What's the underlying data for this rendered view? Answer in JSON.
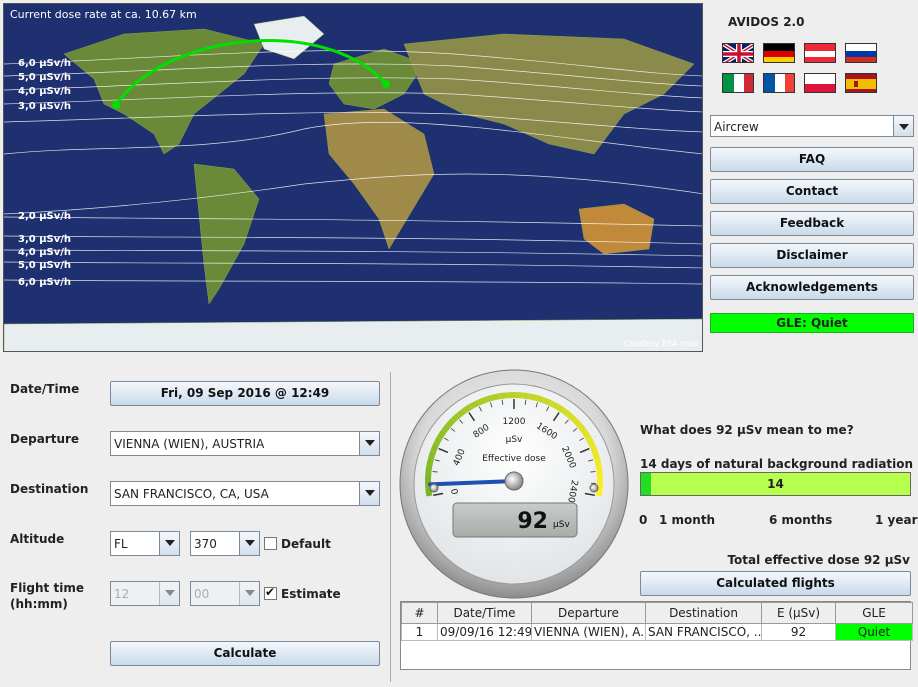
{
  "map": {
    "title": "Current dose rate at ca. 10.67 km",
    "credit": "Courtesy ESA map",
    "dose_labels_north": [
      "6,0 µSv/h",
      "5,0 µSv/h",
      "4,0 µSv/h",
      "3,0 µSv/h"
    ],
    "dose_labels_south": [
      "2,0 µSv/h",
      "3,0 µSv/h",
      "4,0 µSv/h",
      "5,0 µSv/h",
      "6,0 µSv/h"
    ],
    "route_color": "#00e000",
    "ocean_color": "#1d2f6b"
  },
  "sidebar": {
    "app_name": "AVIDOS 2.0",
    "flags": [
      "uk-flag",
      "germany-flag",
      "austria-flag",
      "russia-flag",
      "italy-flag",
      "france-flag",
      "poland-flag",
      "spain-flag"
    ],
    "role_select": "Aircrew",
    "buttons": {
      "faq": "FAQ",
      "contact": "Contact",
      "feedback": "Feedback",
      "disclaimer": "Disclaimer",
      "acknowledgements": "Acknowledgements"
    },
    "gle_status": "GLE: Quiet",
    "gle_color": "#00ff00"
  },
  "form": {
    "datetime_label": "Date/Time",
    "datetime_value": "Fri, 09 Sep 2016 @ 12:49",
    "departure_label": "Departure",
    "departure_value": "VIENNA (WIEN), AUSTRIA",
    "destination_label": "Destination",
    "destination_value": "SAN FRANCISCO, CA, USA",
    "altitude_label": "Altitude",
    "altitude_unit": "FL",
    "altitude_value": "370",
    "default_label": "Default",
    "default_checked": false,
    "flight_time_label": "Flight time",
    "flight_time_unit_label": "(hh:mm)",
    "hours_value": "12",
    "minutes_value": "00",
    "estimate_label": "Estimate",
    "estimate_checked": true,
    "calculate_label": "Calculate"
  },
  "gauge": {
    "unit": "µSv",
    "caption": "Effective dose",
    "ticks": [
      "0",
      "400",
      "800",
      "1200",
      "1600",
      "2000",
      "2400"
    ],
    "max": 2400,
    "value": 92,
    "display_value": "92",
    "display_unit": "µSv"
  },
  "info": {
    "question": "What does 92 µSv mean to me?",
    "comparison_label": "14 days of natural background radiation",
    "bar_value": "14",
    "bar_fraction": 0.038,
    "scale": [
      "0",
      "1 month",
      "6 months",
      "1 year"
    ],
    "total_label": "Total effective dose 92 µSv",
    "calc_flights_label": "Calculated flights"
  },
  "flights": {
    "headers": [
      "#",
      "Date/Time",
      "Departure",
      "Destination",
      "E (µSv)",
      "GLE"
    ],
    "rows": [
      [
        "1",
        "09/09/16 12:49",
        "VIENNA (WIEN), A...",
        "SAN FRANCISCO, ...",
        "92",
        "Quiet"
      ]
    ]
  }
}
